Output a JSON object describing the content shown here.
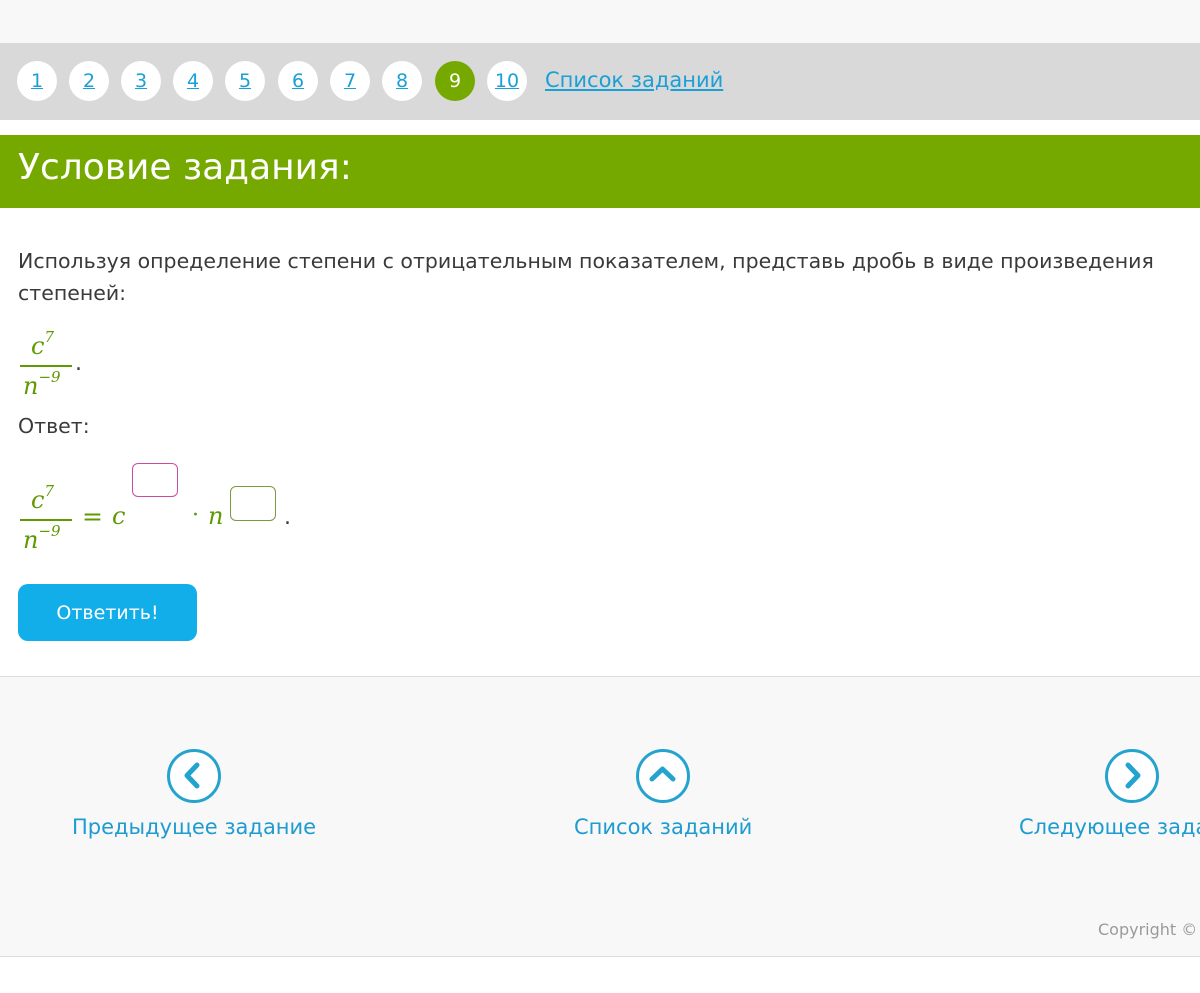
{
  "task_nav": {
    "items": [
      "1",
      "2",
      "3",
      "4",
      "5",
      "6",
      "7",
      "8",
      "9",
      "10"
    ],
    "active": "9",
    "list_link": "Список заданий"
  },
  "header": {
    "title": "Условие задания:"
  },
  "task": {
    "text": "Используя определение степени с отрицательным показателем, представь дробь в виде произведения степеней:",
    "fraction": {
      "numerator_base": "c",
      "numerator_exp": "7",
      "denominator_base": "n",
      "denominator_exp": "−9",
      "trailing": "."
    }
  },
  "answer": {
    "label": "Ответ:",
    "equals": "=",
    "base_c": "c",
    "dot": "·",
    "base_n": "n",
    "trailing": ".",
    "input_c_value": "",
    "input_n_value": "",
    "submit_label": "Ответить!"
  },
  "footer": {
    "prev_label": "Предыдущее задание",
    "list_label": "Список заданий",
    "next_label": "Следующее задание",
    "copyright": "Copyright ©"
  },
  "colors": {
    "accent_green": "#76a900",
    "math_green": "#5e9a00",
    "link_blue": "#1a9fd6",
    "button_blue": "#11aeea",
    "input_c_border": "#c94d9e",
    "input_n_border": "#7a9a40"
  }
}
